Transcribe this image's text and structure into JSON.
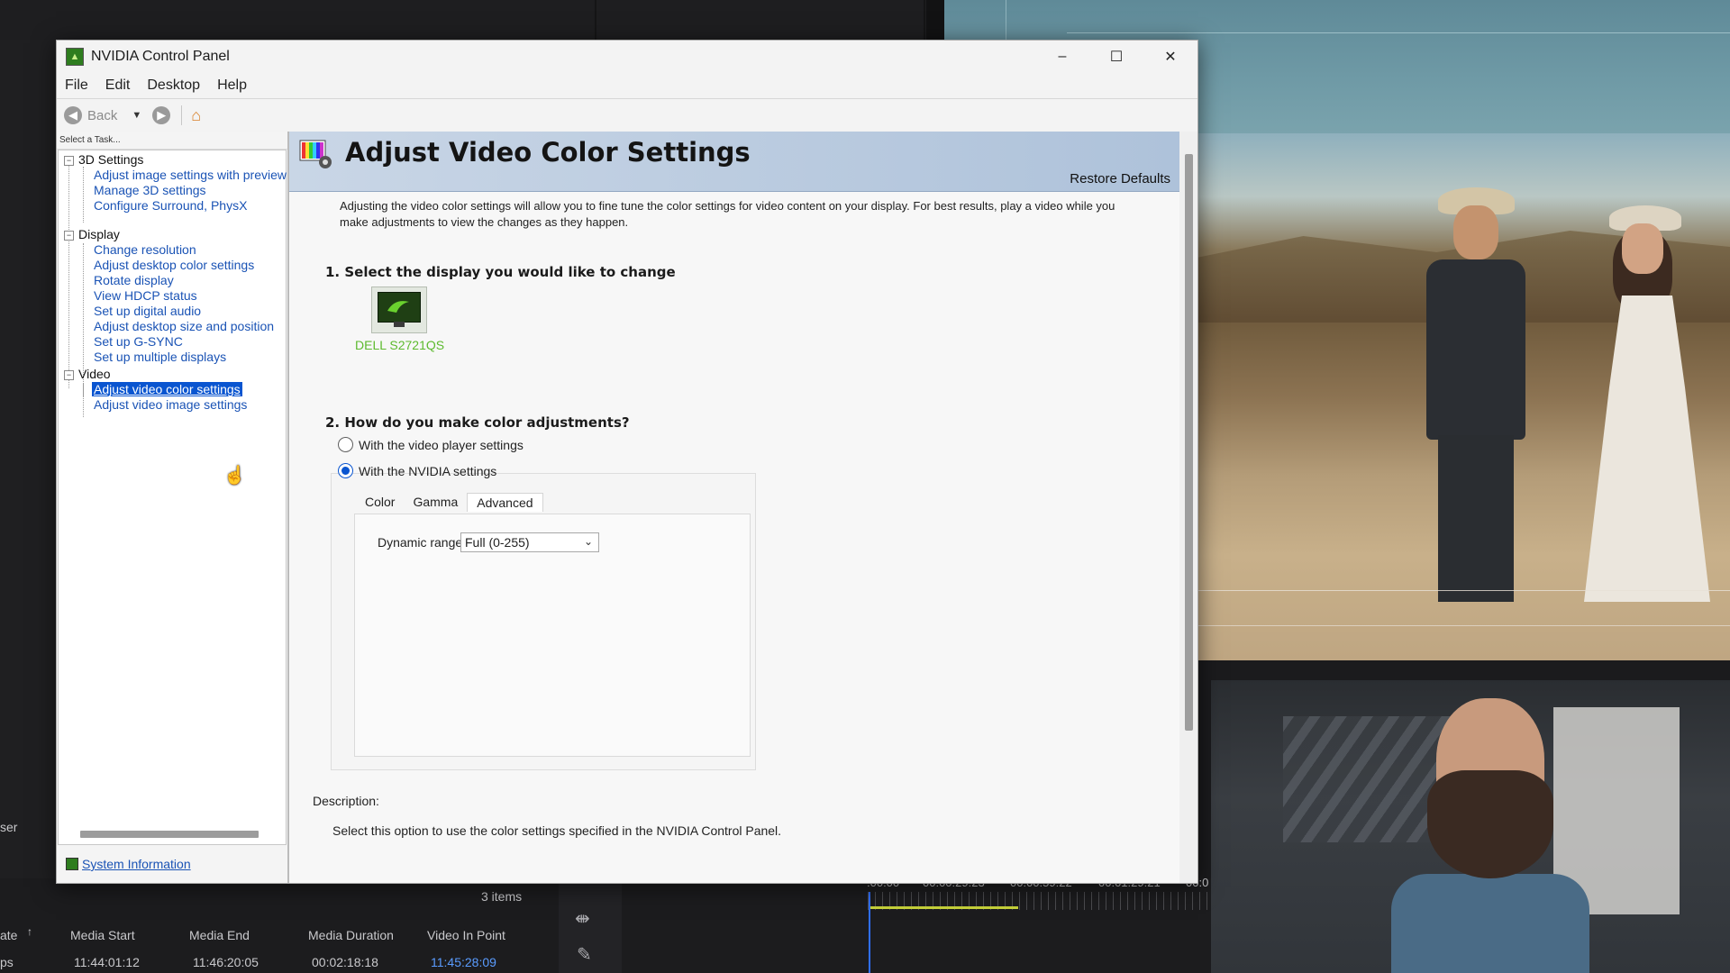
{
  "window": {
    "title": "NVIDIA Control Panel",
    "controls": {
      "minimize": "–",
      "maximize": "☐",
      "close": "✕"
    }
  },
  "menu": [
    "File",
    "Edit",
    "Desktop",
    "Help"
  ],
  "toolbar": {
    "back_label": "Back"
  },
  "left_pane": {
    "header": "Select a Task...",
    "categories": [
      {
        "label": "3D Settings",
        "items": [
          "Adjust image settings with preview",
          "Manage 3D settings",
          "Configure Surround, PhysX"
        ]
      },
      {
        "label": "Display",
        "items": [
          "Change resolution",
          "Adjust desktop color settings",
          "Rotate display",
          "View HDCP status",
          "Set up digital audio",
          "Adjust desktop size and position",
          "Set up G-SYNC",
          "Set up multiple displays"
        ]
      },
      {
        "label": "Video",
        "items": [
          "Adjust video color settings",
          "Adjust video image settings"
        ]
      }
    ],
    "selected_item": "Adjust video color settings",
    "system_information": "System Information"
  },
  "content": {
    "title": "Adjust Video Color Settings",
    "restore_defaults": "Restore Defaults",
    "intro_line1": "Adjusting the video color settings will allow you to fine tune the color settings for video content on your display. For best results, play a video while you",
    "intro_line2": "make adjustments to view the changes as they happen.",
    "step1": "1. Select the display you would like to change",
    "display_name": "DELL S2721QS",
    "step2": "2. How do you make color adjustments?",
    "option_player": "With the video player settings",
    "option_nvidia": "With the NVIDIA settings",
    "selected_option": "With the NVIDIA settings",
    "tabs": [
      "Color",
      "Gamma",
      "Advanced"
    ],
    "active_tab": "Advanced",
    "dynamic_range_label": "Dynamic range:",
    "dynamic_range_value": "Full (0-255)",
    "description_heading": "Description:",
    "description_text": "Select this option to use the color settings specified in the NVIDIA Control Panel."
  },
  "background_app": {
    "items_count": "3 items",
    "columns": [
      "ate",
      "Media Start",
      "Media End",
      "Media Duration",
      "Video In Point"
    ],
    "row": [
      "ps",
      "11:44:01:12",
      "11:46:20:05",
      "00:02:18:18",
      "11:45:28:09"
    ],
    "left_label": "ser",
    "timecodes": [
      ":00:00",
      "00:00:29:23",
      "00:00:59:22",
      "00:01:29:21",
      "00:0"
    ]
  },
  "colors": {
    "accent": "#0a55d0",
    "nvidia_green": "#5dba2e",
    "link": "#1a53b5"
  }
}
